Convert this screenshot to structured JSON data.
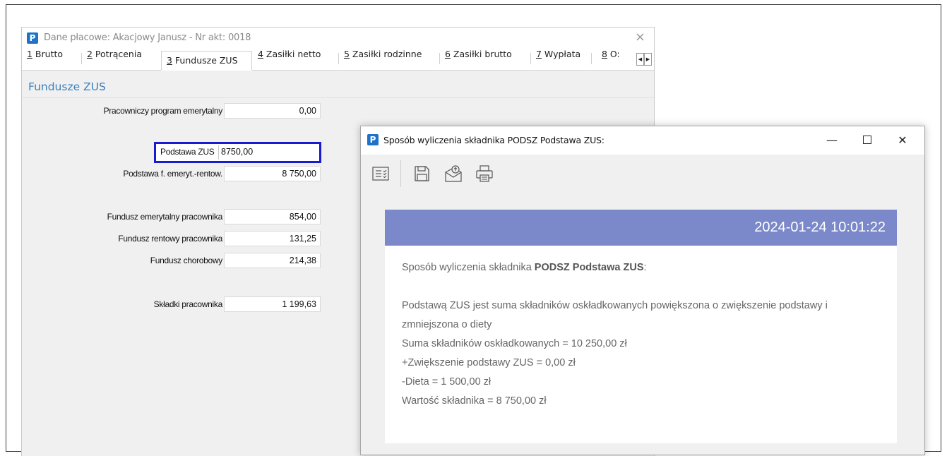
{
  "main_window": {
    "title": "Dane płacowe: Akacjowy Janusz - Nr akt: 0018",
    "close_glyph": "×",
    "tabs": [
      {
        "key": "1",
        "label": " Brutto"
      },
      {
        "key": "2",
        "label": " Potrącenia"
      },
      {
        "key": "3",
        "label": " Fundusze ZUS"
      },
      {
        "key": "4",
        "label": " Zasiłki netto"
      },
      {
        "key": "5",
        "label": " Zasiłki rodzinne"
      },
      {
        "key": "6",
        "label": " Zasiłki brutto"
      },
      {
        "key": "7",
        "label": " Wypłata"
      },
      {
        "key": "8",
        "label": " O:"
      }
    ],
    "active_tab_index": 2,
    "section_title": "Fundusze ZUS",
    "fields": {
      "ppe": {
        "label": "Pracowniczy program emerytalny",
        "value": "0,00"
      },
      "podstawa_zus": {
        "label": "Podstawa ZUS",
        "value": "8750,00"
      },
      "podstawa_fer": {
        "label": "Podstawa f. emeryt.-rentow.",
        "value": "8 750,00"
      },
      "fundusz_emer": {
        "label": "Fundusz emerytalny pracownika",
        "value": "854,00"
      },
      "fundusz_rent": {
        "label": "Fundusz rentowy pracownika",
        "value": "131,25"
      },
      "fundusz_chor": {
        "label": "Fundusz chorobowy",
        "value": "214,38"
      },
      "skladki": {
        "label": "Składki pracownika",
        "value": "1 199,63"
      }
    }
  },
  "popup": {
    "title": "Sposób wyliczenia składnika PODSZ Podstawa ZUS:",
    "controls": {
      "minimize": "—",
      "close": "✕"
    },
    "toolbar_icons": [
      "list-icon",
      "save-icon",
      "email-icon",
      "print-icon"
    ],
    "report": {
      "timestamp": "2024-01-24 10:01:22",
      "intro_prefix": "Sposób wyliczenia składnika ",
      "intro_bold": "PODSZ Podstawa ZUS",
      "intro_suffix": ":",
      "description": "Podstawą ZUS jest suma składników oskładkowanych powiększona o zwiększenie podstawy i zmniejszona o diety",
      "line1": "Suma składników oskładkowanych = 10 250,00 zł",
      "line2": "+Zwiększenie podstawy ZUS = 0,00 zł",
      "line3": "-Dieta = 1 500,00 zł",
      "line4": "Wartość składnika = 8 750,00 zł"
    },
    "header_color": "#7b88c9"
  },
  "app_logo_letter": "P"
}
